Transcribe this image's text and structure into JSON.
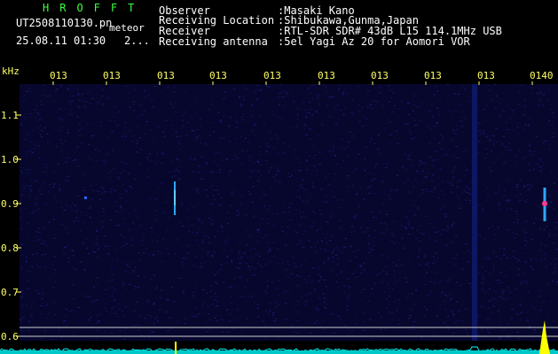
{
  "header": {
    "logo": "HROFFT",
    "filename": "UT2508110130.pn",
    "meteor_label": "meteor",
    "datetime": "25.08.11 01:30",
    "page_indicator": "2..."
  },
  "info": {
    "observer_label": "Observer",
    "observer_value": ":Masaki Kano",
    "location_label": "Receiving Location",
    "location_value": ":Shibukawa,Gunma,Japan",
    "receiver_label": "Receiver",
    "receiver_value": ":RTL-SDR SDR# 43dB L15 114.1MHz USB",
    "antenna_label": "Receiving antenna",
    "antenna_value": ":5el Yagi Az 20 for Aomori VOR"
  },
  "axis": {
    "unit": "kHz",
    "y_ticks": [
      "1.1",
      "1.0",
      "0.9",
      "0.8",
      "0.7",
      "0.6"
    ],
    "x_ticks": [
      "013",
      "013",
      "013",
      "013",
      "013",
      "013",
      "013",
      "013",
      "013",
      "0140"
    ]
  },
  "colors": {
    "background": "#000000",
    "header_green": "#3cff3c",
    "label_yellow": "#ffff66",
    "noise_blue": "#0a0a4a",
    "echo_cyan": "#00ffff",
    "trace_yellow": "#ffff00"
  }
}
